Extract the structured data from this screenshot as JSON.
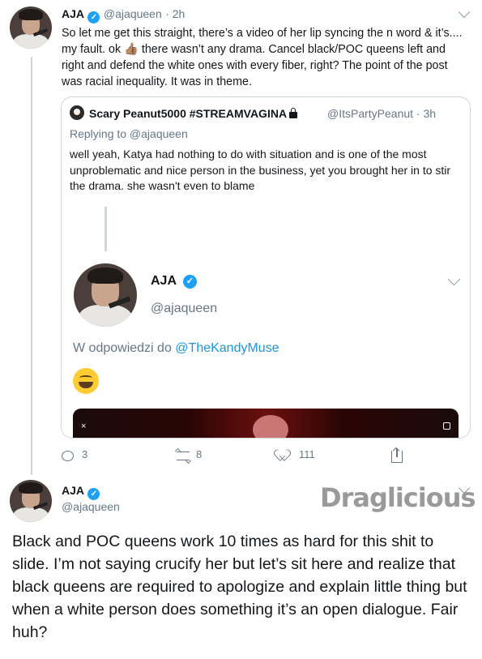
{
  "tweet1": {
    "name": "AJA",
    "handle": "@ajaqueen",
    "time": "· 2h",
    "body": "So let me get this straight, there’s a video of her lip syncing the n word & it’s.... my fault. ok 👍🏽 there wasn’t any drama. Cancel black/POC queens left and right and defend the white ones with every fiber, right? The point of the post was racial inequality. It was in theme."
  },
  "quoted": {
    "name": "Scary Peanut5000 #STREAMVAGINA",
    "handle": "@ItsPartyPeanut · 3h",
    "replying_to": "Replying to @ajaqueen",
    "body": "well yeah, Katya had nothing to do with situation and is one of the most unproblematic and nice person in the business, yet you brought her in to stir the drama. she wasn't even to blame",
    "screenshot": {
      "name": "AJA",
      "handle": "@ajaqueen",
      "reply_prefix": "W odpowiedzi do ",
      "reply_mention": "@TheKandyMuse",
      "emoji": "grinning-face-emoji",
      "video_close": "×"
    }
  },
  "actions": {
    "reply_count": "3",
    "retweet_count": "8",
    "like_count": "111"
  },
  "tweet2": {
    "name": "AJA",
    "handle": "@ajaqueen",
    "body": "Black and POC queens work 10 times as hard for this shit to slide. I’m not saying crucify her but let’s sit here and realize that black queens are required to apologize and explain little thing but when a white person does something it’s an open dialogue. Fair huh?"
  },
  "watermark": "Draglicious",
  "colors": {
    "verified": "#1da1f2",
    "link": "#1b95e0",
    "muted": "#657786",
    "border": "#ccd6dd"
  }
}
